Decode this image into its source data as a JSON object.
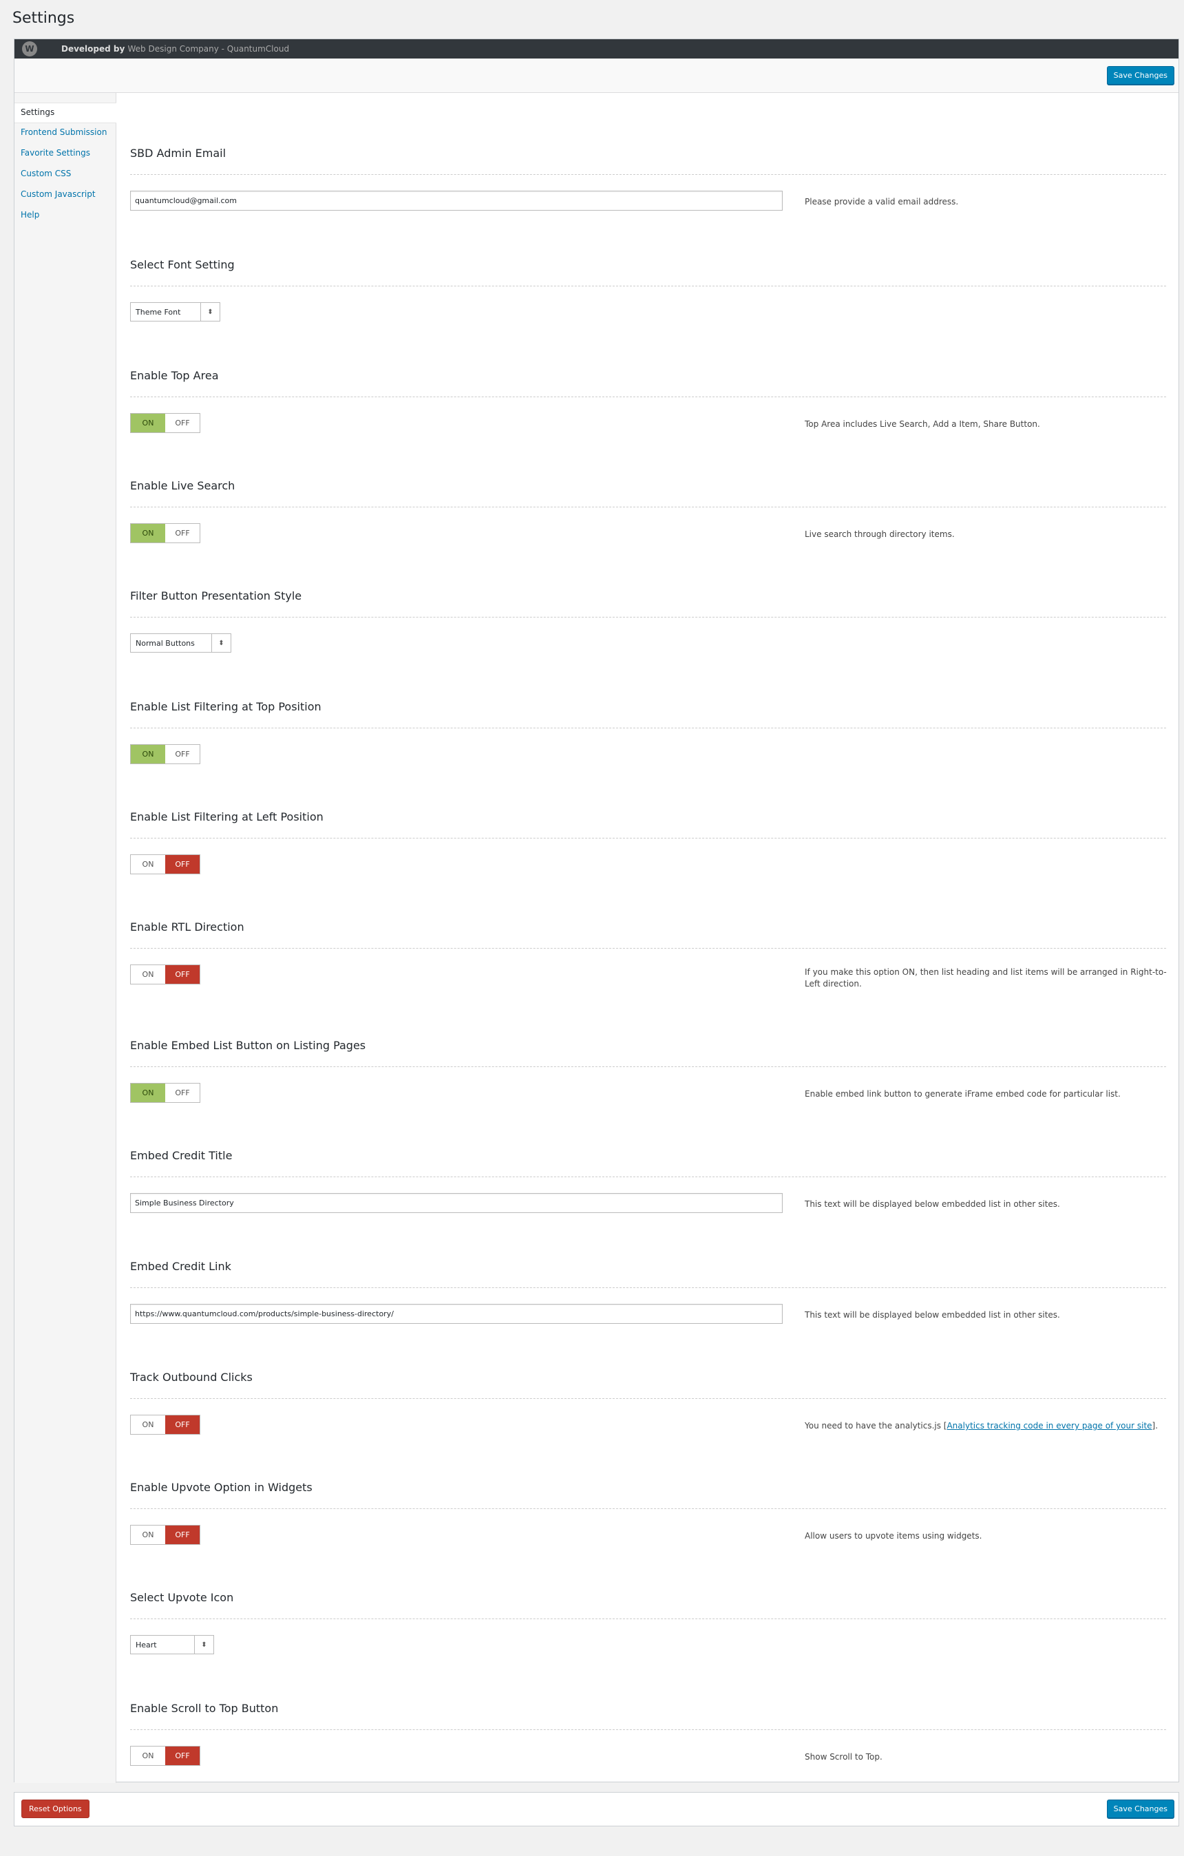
{
  "page_title": "Settings",
  "topbar": {
    "logo": "wordpress-icon",
    "dev_prefix": "Developed by",
    "dev_name": "Web Design Company - QuantumCloud"
  },
  "save_label": "Save Changes",
  "reset_label": "Reset Options",
  "tabs": [
    "Settings",
    "Frontend Submission",
    "Favorite Settings",
    "Custom CSS",
    "Custom Javascript",
    "Help"
  ],
  "fields": {
    "admin_email": {
      "title": "SBD Admin Email",
      "value": "quantumcloud@gmail.com",
      "desc": "Please provide a valid email address."
    },
    "font": {
      "title": "Select Font Setting",
      "value": "Theme Font"
    },
    "top_area": {
      "title": "Enable Top Area",
      "state": "ON",
      "desc": "Top Area includes Live Search, Add a Item, Share Button."
    },
    "live_search": {
      "title": "Enable Live Search",
      "state": "ON",
      "desc": "Live search through directory items."
    },
    "filter_style": {
      "title": "Filter Button Presentation Style",
      "value": "Normal Buttons"
    },
    "filter_top": {
      "title": "Enable List Filtering at Top Position",
      "state": "ON"
    },
    "filter_left": {
      "title": "Enable List Filtering at Left Position",
      "state": "OFF"
    },
    "rtl": {
      "title": "Enable RTL Direction",
      "state": "OFF",
      "desc": "If you make this option ON, then list heading and list items will be arranged in Right-to-Left direction."
    },
    "embed_btn": {
      "title": "Enable Embed List Button on Listing Pages",
      "state": "ON",
      "desc": "Enable embed link button to generate iFrame embed code for particular list."
    },
    "embed_title": {
      "title": "Embed Credit Title",
      "value": "Simple Business Directory",
      "desc": "This text will be displayed below embedded list in other sites."
    },
    "embed_link": {
      "title": "Embed Credit Link",
      "value": "https://www.quantumcloud.com/products/simple-business-directory/",
      "desc": "This text will be displayed below embedded list in other sites."
    },
    "track": {
      "title": "Track Outbound Clicks",
      "state": "OFF",
      "desc_pre": "You need to have the analytics.js [",
      "desc_link": "Analytics tracking code in every page of your site",
      "desc_post": "]."
    },
    "upvote_widgets": {
      "title": "Enable Upvote Option in Widgets",
      "state": "OFF",
      "desc": "Allow users to upvote items using widgets."
    },
    "upvote_icon": {
      "title": "Select Upvote Icon",
      "value": "Heart"
    },
    "scroll_top": {
      "title": "Enable Scroll to Top Button",
      "state": "OFF",
      "desc": "Show Scroll to Top."
    }
  },
  "toggle_labels": {
    "on": "ON",
    "off": "OFF"
  },
  "colors": {
    "on": "#a0c463",
    "off": "#c0392b",
    "primary": "#0085ba"
  }
}
